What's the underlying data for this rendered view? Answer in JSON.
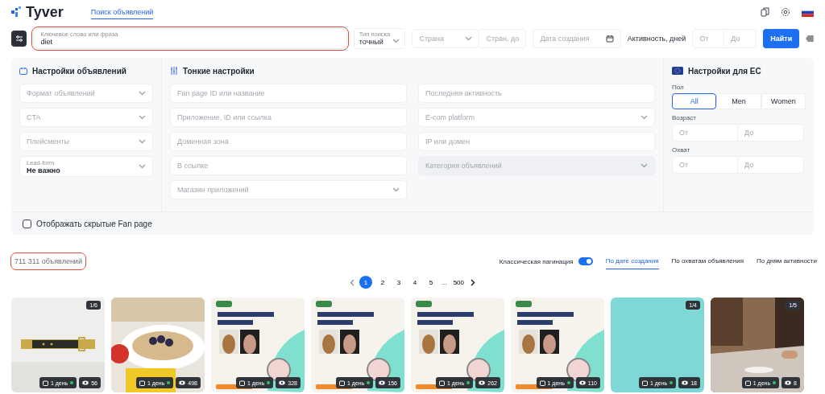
{
  "header": {
    "logo": "Tyver",
    "nav": [
      {
        "label": "Поиск объявлений",
        "selected": true
      }
    ]
  },
  "search": {
    "keyword": {
      "label": "Ключевое слово или фраза",
      "value": "diet",
      "highlighted": true
    },
    "search_type": {
      "label": "Тип поиска",
      "value": "точный"
    },
    "country": {
      "placeholder": "Страна"
    },
    "country_to": {
      "placeholder": "Стран, до"
    },
    "date": {
      "placeholder": "Дата создания"
    },
    "activity": {
      "label": "Активность, дней",
      "from": {
        "placeholder": "От"
      },
      "to": {
        "placeholder": "До"
      }
    },
    "submit": "Найти"
  },
  "panel": {
    "ad_settings": {
      "title": "Настройки объявлений",
      "fields": [
        {
          "kind": "select",
          "placeholder": "Формат объявлений"
        },
        {
          "kind": "select",
          "placeholder": "CTA"
        },
        {
          "kind": "select",
          "placeholder": "Плейсменты"
        },
        {
          "kind": "labeled",
          "label": "Lead-form",
          "value": "Не важно"
        }
      ]
    },
    "fine_settings": {
      "title": "Тонкие настройки",
      "columns": [
        [
          {
            "kind": "input",
            "placeholder": "Fan page ID или название",
            "disabled": false
          },
          {
            "kind": "input",
            "placeholder": "Приложение, ID или ссылка",
            "disabled": false
          },
          {
            "kind": "input",
            "placeholder": "Доменная зона",
            "disabled": false
          },
          {
            "kind": "input",
            "placeholder": "В ссылке",
            "disabled": false
          },
          {
            "kind": "select",
            "placeholder": "Магазин приложений",
            "disabled": false
          }
        ],
        [
          {
            "kind": "input",
            "placeholder": "Последняя активность",
            "disabled": false
          },
          {
            "kind": "select",
            "placeholder": "E-com platform",
            "disabled": false
          },
          {
            "kind": "input",
            "placeholder": "IP или домен",
            "disabled": false
          },
          {
            "kind": "select",
            "placeholder": "Категория объявлений",
            "disabled": true
          }
        ]
      ]
    },
    "eu_settings": {
      "title": "Настройки для ЕС",
      "gender_label": "Пол",
      "genders": [
        {
          "label": "All",
          "selected": true
        },
        {
          "label": "Men",
          "selected": false
        },
        {
          "label": "Women",
          "selected": false
        }
      ],
      "age": {
        "label": "Возраст",
        "from": {
          "placeholder": "От"
        },
        "to": {
          "placeholder": "До"
        }
      },
      "reach": {
        "label": "Охват",
        "from": {
          "placeholder": "От"
        },
        "to": {
          "placeholder": "До"
        }
      }
    },
    "hidden_pages": {
      "label": "Отображать скрытые Fan page",
      "checked": false
    }
  },
  "results": {
    "count": "711 311 объявлений",
    "count_highlighted": true,
    "classic_pagination": {
      "label": "Классическая пагинация",
      "on": true
    },
    "sort_tabs": [
      {
        "label": "По дате создания",
        "selected": true
      },
      {
        "label": "По охватам объявления",
        "selected": false
      },
      {
        "label": "По дням активности",
        "selected": false
      }
    ]
  },
  "pagination": {
    "pages": [
      {
        "label": "1",
        "selected": true
      },
      {
        "label": "2",
        "selected": false
      },
      {
        "label": "3",
        "selected": false
      },
      {
        "label": "4",
        "selected": false
      },
      {
        "label": "5",
        "selected": false
      }
    ],
    "ellipsis": "...",
    "last": "500"
  },
  "cards": [
    {
      "kind": "product",
      "media_count": "1/6",
      "age": "1 день",
      "views": "56"
    },
    {
      "kind": "food",
      "age": "1 день",
      "views": "498"
    },
    {
      "kind": "promo",
      "age": "1 день",
      "views": "328"
    },
    {
      "kind": "promo",
      "age": "1 день",
      "views": "156"
    },
    {
      "kind": "promo",
      "age": "1 день",
      "views": "262"
    },
    {
      "kind": "promo",
      "age": "1 день",
      "views": "110"
    },
    {
      "kind": "plain",
      "media_count": "1/4",
      "age": "1 день",
      "views": "18"
    },
    {
      "kind": "room",
      "media_count": "1/5",
      "age": "1 день",
      "views": "8"
    }
  ]
}
